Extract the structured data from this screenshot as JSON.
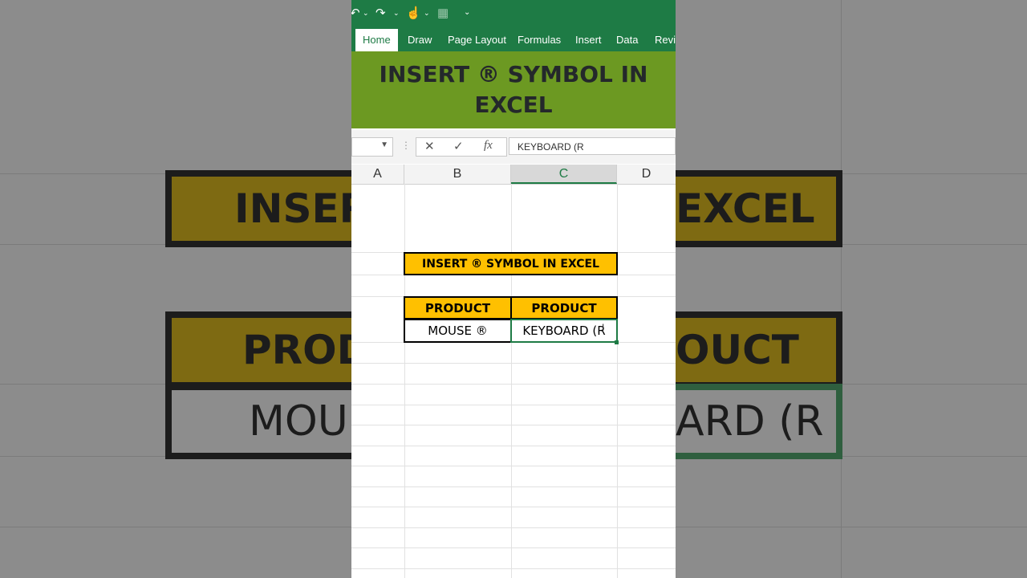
{
  "quick_access": {
    "undo": "↶",
    "redo": "↷",
    "touch": "☝",
    "calc": "▦",
    "more": "⌄"
  },
  "ribbon_tabs": [
    {
      "label": "Home",
      "active": true
    },
    {
      "label": "Draw"
    },
    {
      "label": "Page Layout"
    },
    {
      "label": "Formulas"
    },
    {
      "label": "Insert"
    },
    {
      "label": "Data"
    },
    {
      "label": "Revie"
    }
  ],
  "banner": {
    "title": "INSERT ® SYMBOL IN EXCEL"
  },
  "formula_bar": {
    "cancel": "✕",
    "enter": "✓",
    "fx": "fx",
    "value": "KEYBOARD (R"
  },
  "columns": [
    "A",
    "B",
    "C",
    "D"
  ],
  "sheet": {
    "title_cell": "INSERT ® SYMBOL IN EXCEL",
    "headers": [
      "PRODUCT",
      "PRODUCT"
    ],
    "values": [
      "MOUSE ®",
      "KEYBOARD (R"
    ]
  },
  "background_zoom": {
    "title_fragment_left": "INSER",
    "title_fragment_right": "EXCEL",
    "header_fragment_left": "PROD",
    "header_fragment_right": "OUCT",
    "value_fragment_left": "MOU",
    "value_fragment_right": "ARD (R"
  },
  "colors": {
    "excel_green": "#1e7b45",
    "banner_green": "#6c9922",
    "header_yellow": "#ffc000"
  }
}
